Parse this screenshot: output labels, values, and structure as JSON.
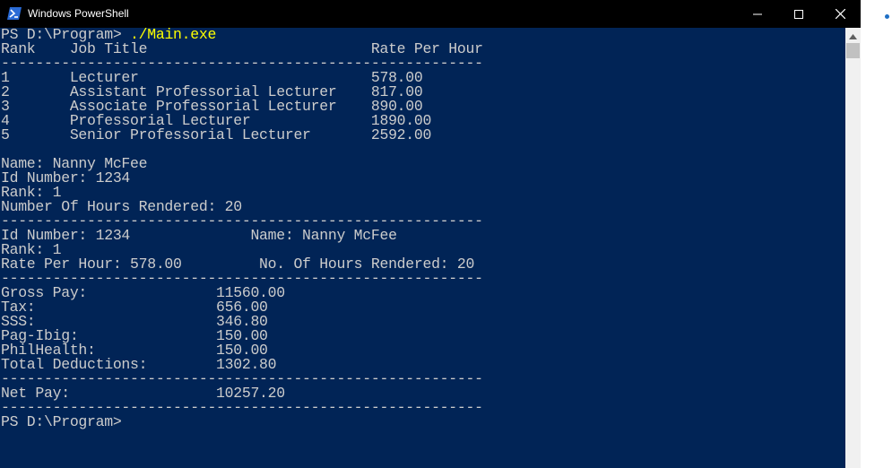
{
  "window": {
    "title": "Windows PowerShell"
  },
  "icons": {
    "app": "powershell-icon",
    "minimize": "minimize-icon",
    "maximize": "maximize-icon",
    "close": "close-icon",
    "scroll_up": "chevron-up-icon"
  },
  "colors": {
    "console_bg": "#012456",
    "console_text": "#cccccc",
    "command_text": "#ffff00",
    "titlebar_bg": "#000000"
  },
  "console": {
    "prompt_1": "PS D:\\Program>",
    "command_1": " ./Main.exe",
    "rate_table": {
      "header": "Rank    Job Title                          Rate Per Hour",
      "divider": "--------------------------------------------------------",
      "rows": [
        "1       Lecturer                           578.00",
        "2       Assistant Professorial Lecturer    817.00",
        "3       Associate Professorial Lecturer    890.00",
        "4       Professorial Lecturer              1890.00",
        "5       Senior Professorial Lecturer       2592.00"
      ]
    },
    "input_info": [
      "Name: Nanny McFee",
      "Id Number: 1234",
      "Rank: 1",
      "Number Of Hours Rendered: 20"
    ],
    "divider_2": "--------------------------------------------------------",
    "summary": [
      "Id Number: 1234              Name: Nanny McFee",
      "Rank: 1",
      "Rate Per Hour: 578.00         No. Of Hours Rendered: 20"
    ],
    "divider_3": "--------------------------------------------------------",
    "deductions": [
      "Gross Pay:               11560.00",
      "Tax:                     656.00",
      "SSS:                     346.80",
      "Pag-Ibig:                150.00",
      "PhilHealth:              150.00",
      "Total Deductions:        1302.80"
    ],
    "divider_4": "--------------------------------------------------------",
    "net_pay": "Net Pay:                 10257.20",
    "divider_5": "--------------------------------------------------------",
    "prompt_2": "PS D:\\Program>"
  }
}
